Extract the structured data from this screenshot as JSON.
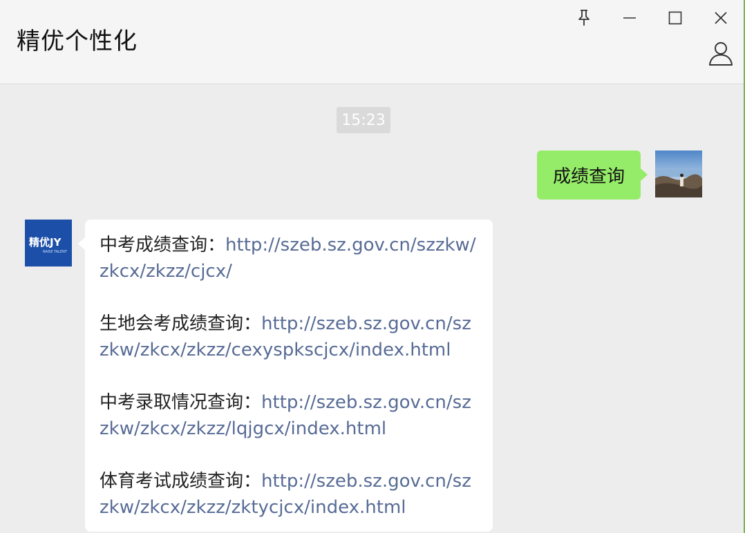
{
  "window": {
    "title": "精优个性化"
  },
  "chat": {
    "timestamp": "15:23",
    "outgoing_message": "成绩查询",
    "bot_avatar_text": "精优JY",
    "bot_avatar_subtext": "RAISE TALENT",
    "entries": [
      {
        "label": "中考成绩查询：",
        "url": "http://szeb.sz.gov.cn/szzkw/zkcx/zkzz/cjcx/"
      },
      {
        "label": "生地会考成绩查询：",
        "url": "http://szeb.sz.gov.cn/szzkw/zkcx/zkzz/cexyspkscjcx/index.html"
      },
      {
        "label": "中考录取情况查询：",
        "url": "http://szeb.sz.gov.cn/szzkw/zkcx/zkzz/lqjgcx/index.html"
      },
      {
        "label": "体育考试成绩查询：",
        "url": "http://szeb.sz.gov.cn/szzkw/zkcx/zkzz/zktycjcx/index.html"
      }
    ]
  },
  "icons": {
    "pin": "pin-icon",
    "minimize": "minimize-icon",
    "maximize": "maximize-icon",
    "close": "close-icon",
    "profile": "person-icon"
  },
  "colors": {
    "outgoing_bubble": "#95ec69",
    "link": "#576b95",
    "bot_avatar_bg": "#1c4fa8"
  }
}
